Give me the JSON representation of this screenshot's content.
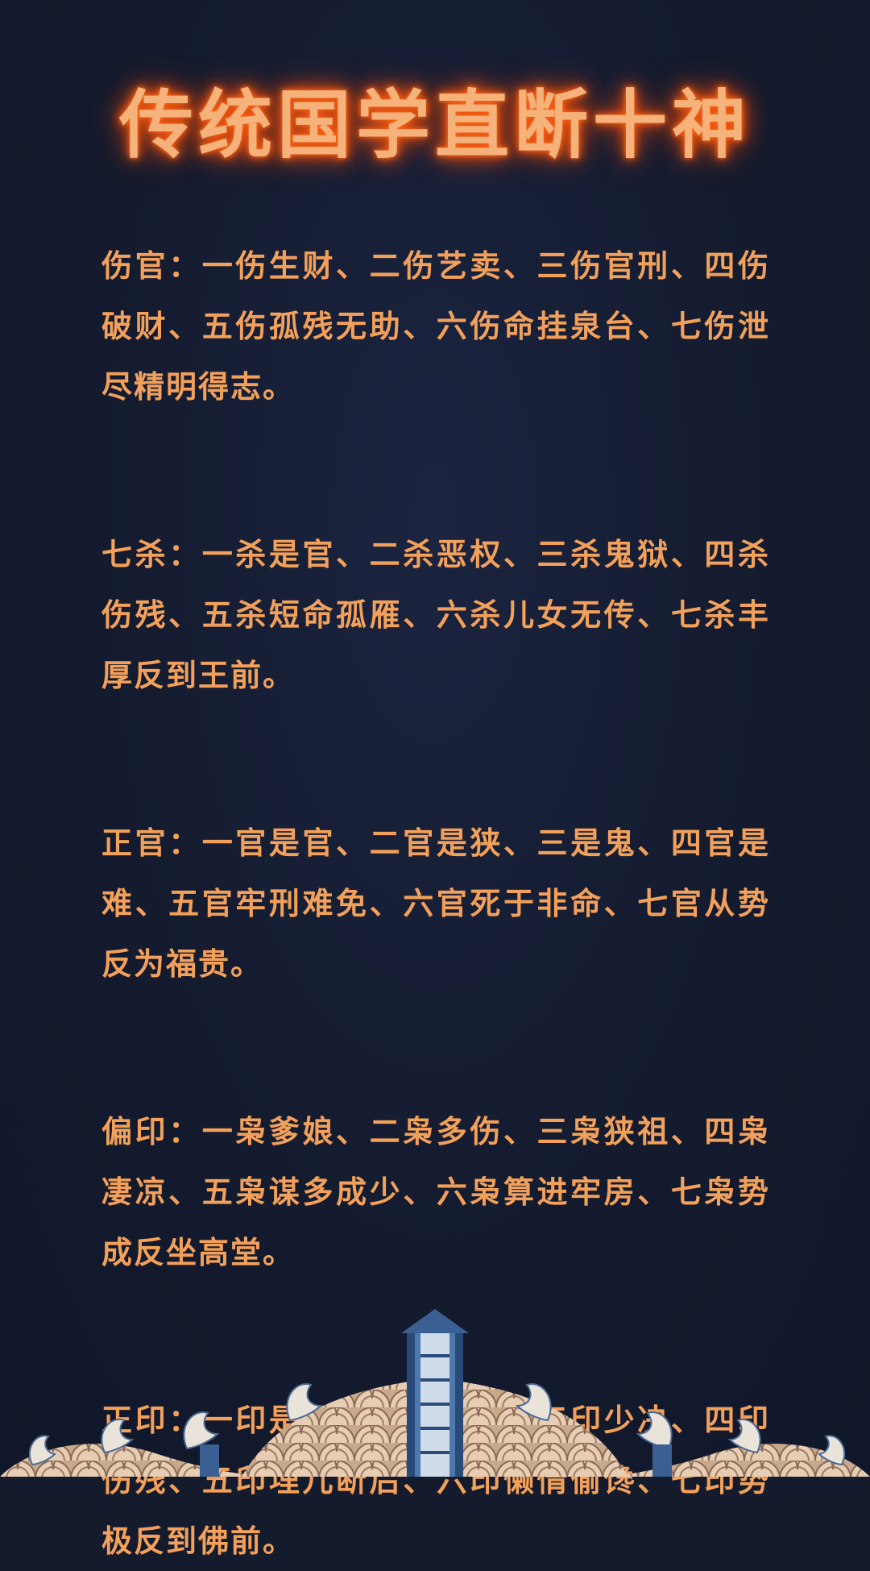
{
  "title": "传统国学直断十神",
  "sections": [
    {
      "label": "伤官：",
      "text": "一伤生财、二伤艺卖、三伤官刑、四伤破财、五伤孤残无助、六伤命挂泉台、七伤泄尽精明得志。"
    },
    {
      "label": "七杀：",
      "text": "一杀是官、二杀恶权、三杀鬼狱、四杀伤残、五杀短命孤雁、六杀儿女无传、七杀丰厚反到王前。"
    },
    {
      "label": "正官：",
      "text": "一官是官、二官是狭、三是鬼、四官是难、五官牢刑难免、六官死于非命、七官从势反为福贵。"
    },
    {
      "label": "偏印：",
      "text": "一枭爹娘、二枭多伤、三枭狭祖、四枭凄凉、五枭谋多成少、六枭算进牢房、七枭势成反坐高堂。"
    },
    {
      "label": "正印：",
      "text": "一印是权、二印贵人、三印少决、四印伤残、五印埋儿断后、六印懒情偷馋、七印势极反到佛前。"
    }
  ],
  "colors": {
    "background": "#141b2d",
    "title": "#f5b27a",
    "title_glow": "#ff5a10",
    "text": "#f2a05a",
    "decoration_base": "#d8b89a",
    "decoration_blue": "#2a4a7a"
  },
  "decoration": "wave-pagoda-pattern"
}
